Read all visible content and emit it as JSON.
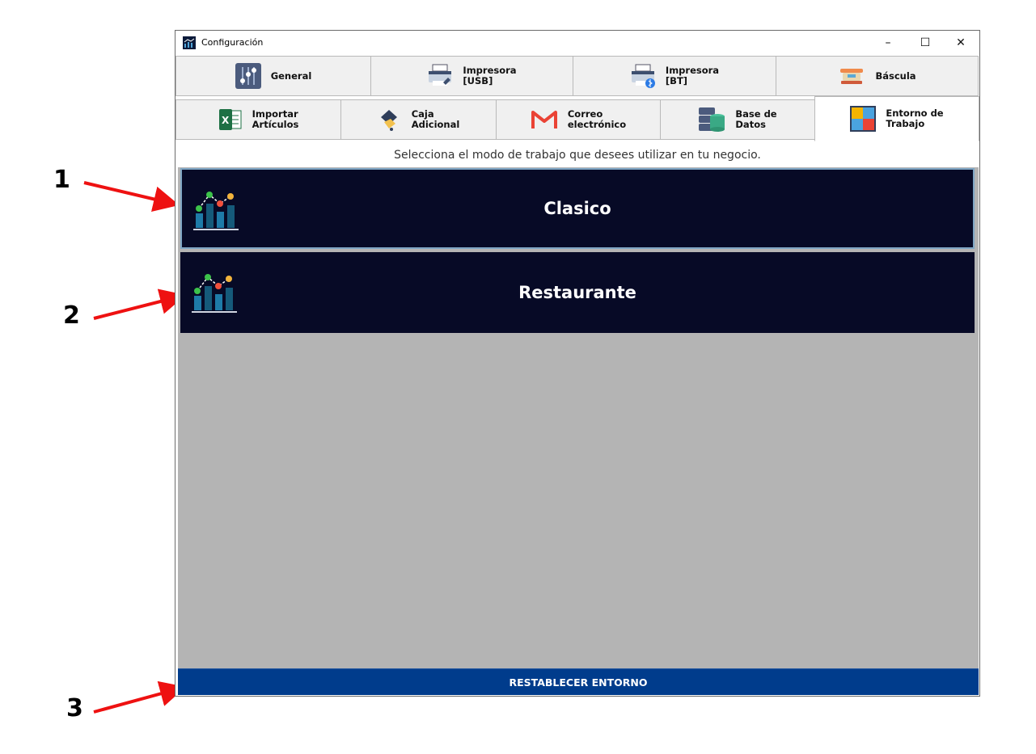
{
  "window": {
    "title": "Configuración",
    "controls": {
      "minimize": "–",
      "maximize": "☐",
      "close": "✕"
    }
  },
  "tabs_row1": [
    {
      "label": "General",
      "icon": "sliders-icon"
    },
    {
      "label": "Impresora\n[USB]",
      "icon": "printer-usb-icon"
    },
    {
      "label": "Impresora\n[BT]",
      "icon": "printer-bluetooth-icon"
    },
    {
      "label": "Báscula",
      "icon": "scale-icon"
    }
  ],
  "tabs_row2": [
    {
      "label": "Importar\nArtículos",
      "icon": "excel-icon"
    },
    {
      "label": "Caja\nAdicional",
      "icon": "cash-drawer-icon"
    },
    {
      "label": "Correo\nelectrónico",
      "icon": "gmail-icon"
    },
    {
      "label": "Base de\nDatos",
      "icon": "database-icon"
    },
    {
      "label": "Entorno de\nTrabajo",
      "icon": "puzzle-icon",
      "active": true
    }
  ],
  "instruction": "Selecciona el modo de trabajo que desees utilizar en tu negocio.",
  "modes": [
    {
      "label": "Clasico",
      "icon": "chart-icon",
      "selected": true
    },
    {
      "label": "Restaurante",
      "icon": "chart-icon",
      "selected": false
    }
  ],
  "reset_button": "RESTABLECER ENTORNO",
  "annotations": [
    "1",
    "2",
    "3"
  ],
  "colors": {
    "mode_bg": "#070a26",
    "reset_bg": "#003c8c",
    "content_bg": "#b4b4b4",
    "arrow": "#ee1111"
  }
}
